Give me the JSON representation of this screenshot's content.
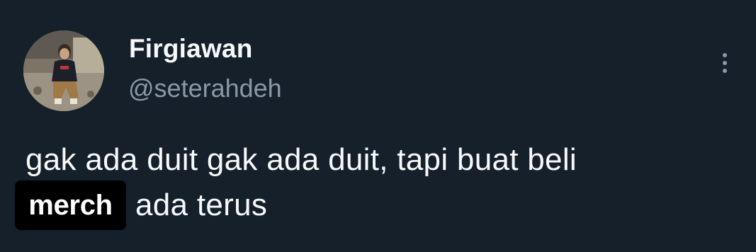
{
  "author": {
    "display_name": "Firgiawan",
    "handle": "@seterahdeh"
  },
  "tweet": {
    "line1": "gak ada duit gak ada duit, tapi buat beli",
    "tag": "merch",
    "line2": "ada terus"
  },
  "icons": {
    "more": "more-vertical-icon"
  },
  "colors": {
    "background": "#15202b",
    "primary_text": "#f7f9f9",
    "secondary_text": "#8b98a5",
    "tag_background": "#000000"
  }
}
